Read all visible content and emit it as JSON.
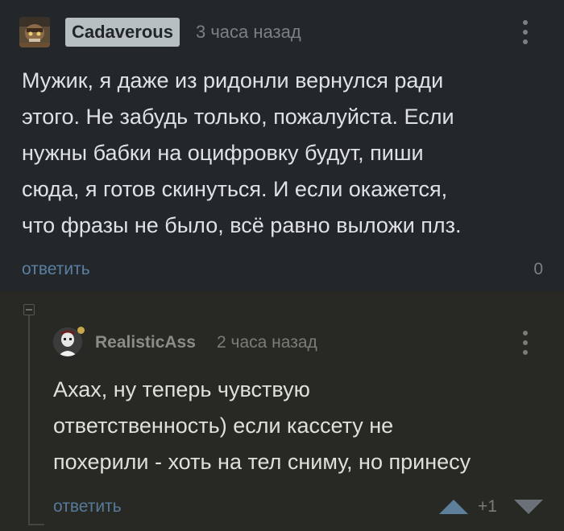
{
  "comments": [
    {
      "author": "Cadaverous",
      "time": "3 часа назад",
      "text": "Мужик, я даже из ридонли вернулся ради\nэтого. Не забудь только, пожалуйста. Если\nнужны бабки на оцифровку будут, пиши\nсюда, я готов скинуться. И если окажется,\nчто фразы не было, всё равно выложи плз.",
      "reply_label": "ответить",
      "count": "0",
      "avatar_icon": "avatar-icon",
      "menu_icon": "more-vertical-icon"
    },
    {
      "author": "RealisticAss",
      "time": "2 часа назад",
      "text": "Ахах, ну теперь чувствую\nответственность) если кассету не\nпохерили - хоть на тел сниму, но принесу",
      "reply_label": "ответить",
      "rating": "+1",
      "avatar_icon": "avatar-icon",
      "menu_icon": "more-vertical-icon",
      "upvote_icon": "upvote-arrow-icon",
      "downvote_icon": "downvote-arrow-icon",
      "collapse_icon": "collapse-thread-icon"
    }
  ],
  "colors": {
    "background": "#24272a",
    "nested_background": "#282924",
    "username_badge": "#b8bfc3",
    "link": "#5a7fa3",
    "muted": "#7c8085",
    "online_dot": "#c9a84c"
  }
}
